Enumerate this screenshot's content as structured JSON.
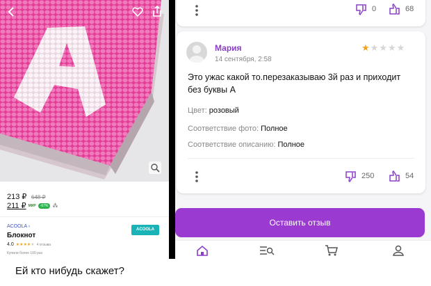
{
  "product": {
    "price": "213 ₽",
    "old_price": "648 ₽",
    "card_price": "211 ₽",
    "card_tag": "МИР",
    "pct_badge": "-67%",
    "brand": "ACOOLA ›",
    "name": "Блокнот",
    "rating": "4.0",
    "reviews": "4 отзыва",
    "bought": "Купили более 100 раз",
    "shop_badge": "ACOOLA",
    "accent": "#e8308a"
  },
  "top_actions": {
    "dislikes": "0",
    "likes": "68"
  },
  "review": {
    "author": "Мария",
    "date": "14 сентября, 2:58",
    "stars": 1,
    "max_stars": 5,
    "text": "Это ужас какой то.перезаказываю 3й раз и приходит без буквы А",
    "color_label": "Цвет:",
    "color_value": "розовый",
    "photo_label": "Соответствие фото:",
    "photo_value": "Полное",
    "desc_label": "Соответствие описанию:",
    "desc_value": "Полное",
    "dislikes": "250",
    "likes": "54"
  },
  "cta": {
    "label": "Оставить отзыв",
    "color": "#9b3ad0"
  },
  "bottom_nav": [
    "home-icon",
    "catalog-search-icon",
    "cart-icon",
    "profile-icon"
  ],
  "caption": "Ей кто нибудь скажет?"
}
